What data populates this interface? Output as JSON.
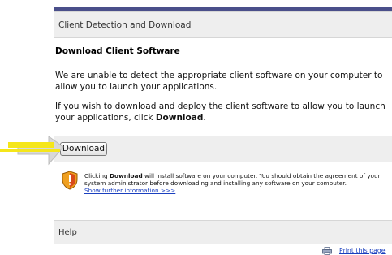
{
  "header": {
    "section_title": "Client Detection and Download"
  },
  "main": {
    "title": "Download Client Software",
    "paragraph1": "We are unable to detect the appropriate client software on your computer to allow you to launch your applications.",
    "paragraph2_prefix": "If you wish to download and deploy the client software to allow you to launch your applications, click ",
    "paragraph2_bold": "Download",
    "paragraph2_suffix": ".",
    "download_button": "Download"
  },
  "notice": {
    "prefix": "Clicking ",
    "bold": "Download",
    "body": " will install software on your computer. You should obtain the agreement of your system administrator before downloading and installing any software on your computer.",
    "link": "Show further information >>>"
  },
  "help": {
    "label": "Help"
  },
  "footer": {
    "print_link": "Print this page"
  },
  "colors": {
    "accent_bar": "#4a4f8a",
    "link": "#1a3fbf",
    "arrow": "#f5e61a",
    "panel_bg": "#eeeeee"
  },
  "icons": {
    "shield": "security-shield-icon",
    "print": "printer-icon",
    "arrow": "pointer-arrow-icon"
  }
}
